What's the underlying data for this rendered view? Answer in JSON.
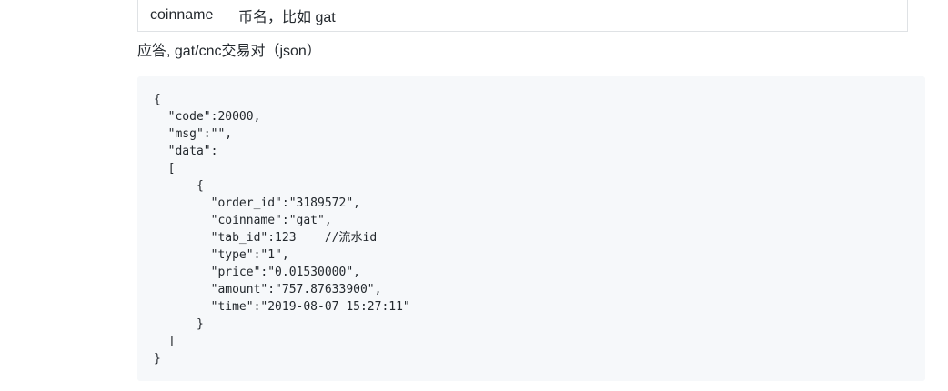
{
  "param_table": {
    "rows": [
      {
        "name": "coinname",
        "desc": "币名，比如 gat"
      }
    ]
  },
  "response_label": "应答, gat/cnc交易对（json）",
  "code_lines": [
    "{",
    "  \"code\":20000,",
    "  \"msg\":\"\",",
    "  \"data\":",
    "  [",
    "      {",
    "        \"order_id\":\"3189572\",",
    "        \"coinname\":\"gat\",",
    "        \"tab_id\":123    //流水id",
    "        \"type\":\"1\",",
    "        \"price\":\"0.01530000\",",
    "        \"amount\":\"757.87633900\",",
    "        \"time\":\"2019-08-07 15:27:11\"",
    "      }",
    "  ]",
    "}"
  ]
}
